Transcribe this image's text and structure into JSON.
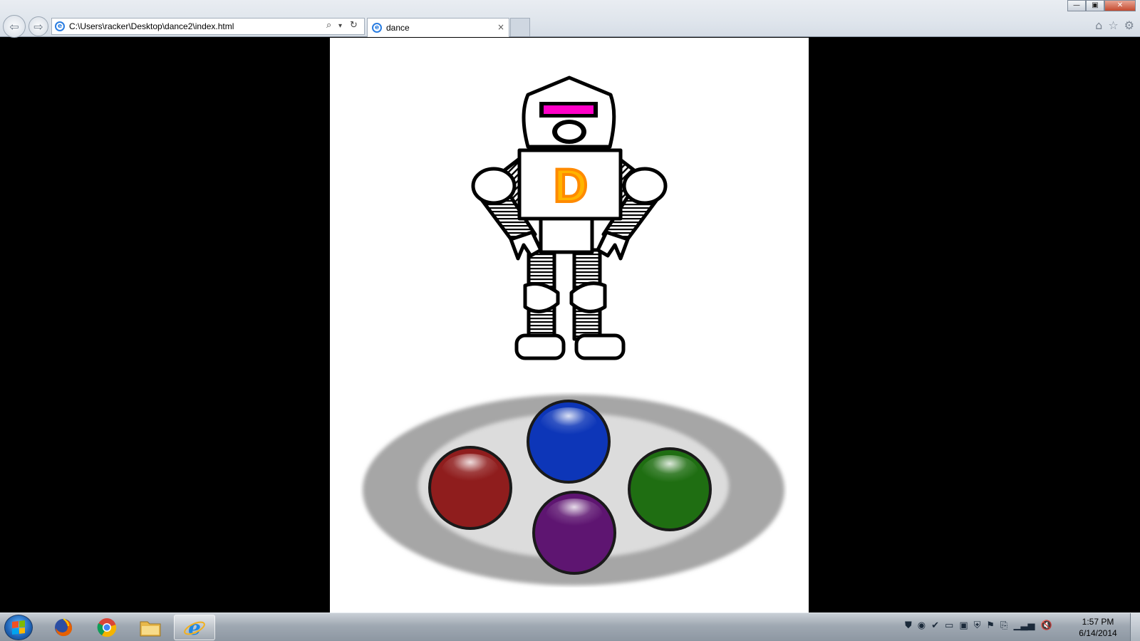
{
  "browser": {
    "address": "C:\\Users\\racker\\Desktop\\dance2\\index.html",
    "tab_title": "dance",
    "tab_close": "×",
    "back_glyph": "⇦",
    "forward_glyph": "⇨",
    "search_glyph": "⌕",
    "dropdown_glyph": "▾",
    "refresh_glyph": "↻",
    "home_glyph": "⌂",
    "favorites_glyph": "☆",
    "tools_glyph": "⚙",
    "min_glyph": "—",
    "max_glyph": "▣",
    "close_glyph": "✕"
  },
  "game": {
    "robot_chest_letter": "D",
    "robot_visor_color": "#ff00c8",
    "robot_letter_fill": "#ffb400",
    "robot_letter_stroke": "#ff8a00",
    "pad_buttons": [
      {
        "name": "red",
        "color": "#8f1d1d"
      },
      {
        "name": "blue",
        "color": "#0d36b8"
      },
      {
        "name": "green",
        "color": "#1f6e12"
      },
      {
        "name": "purple",
        "color": "#5e1571"
      }
    ]
  },
  "taskbar": {
    "pinned": [
      "firefox",
      "chrome",
      "file-explorer",
      "internet-explorer"
    ],
    "active": "internet-explorer",
    "tray_glyphs": [
      "⛊",
      "◉",
      "✔",
      "▭",
      "▣",
      "⛨",
      "⚑",
      "⎘",
      "▁▃▅",
      "🔇"
    ],
    "time": "1:57 PM",
    "date": "6/14/2014"
  }
}
